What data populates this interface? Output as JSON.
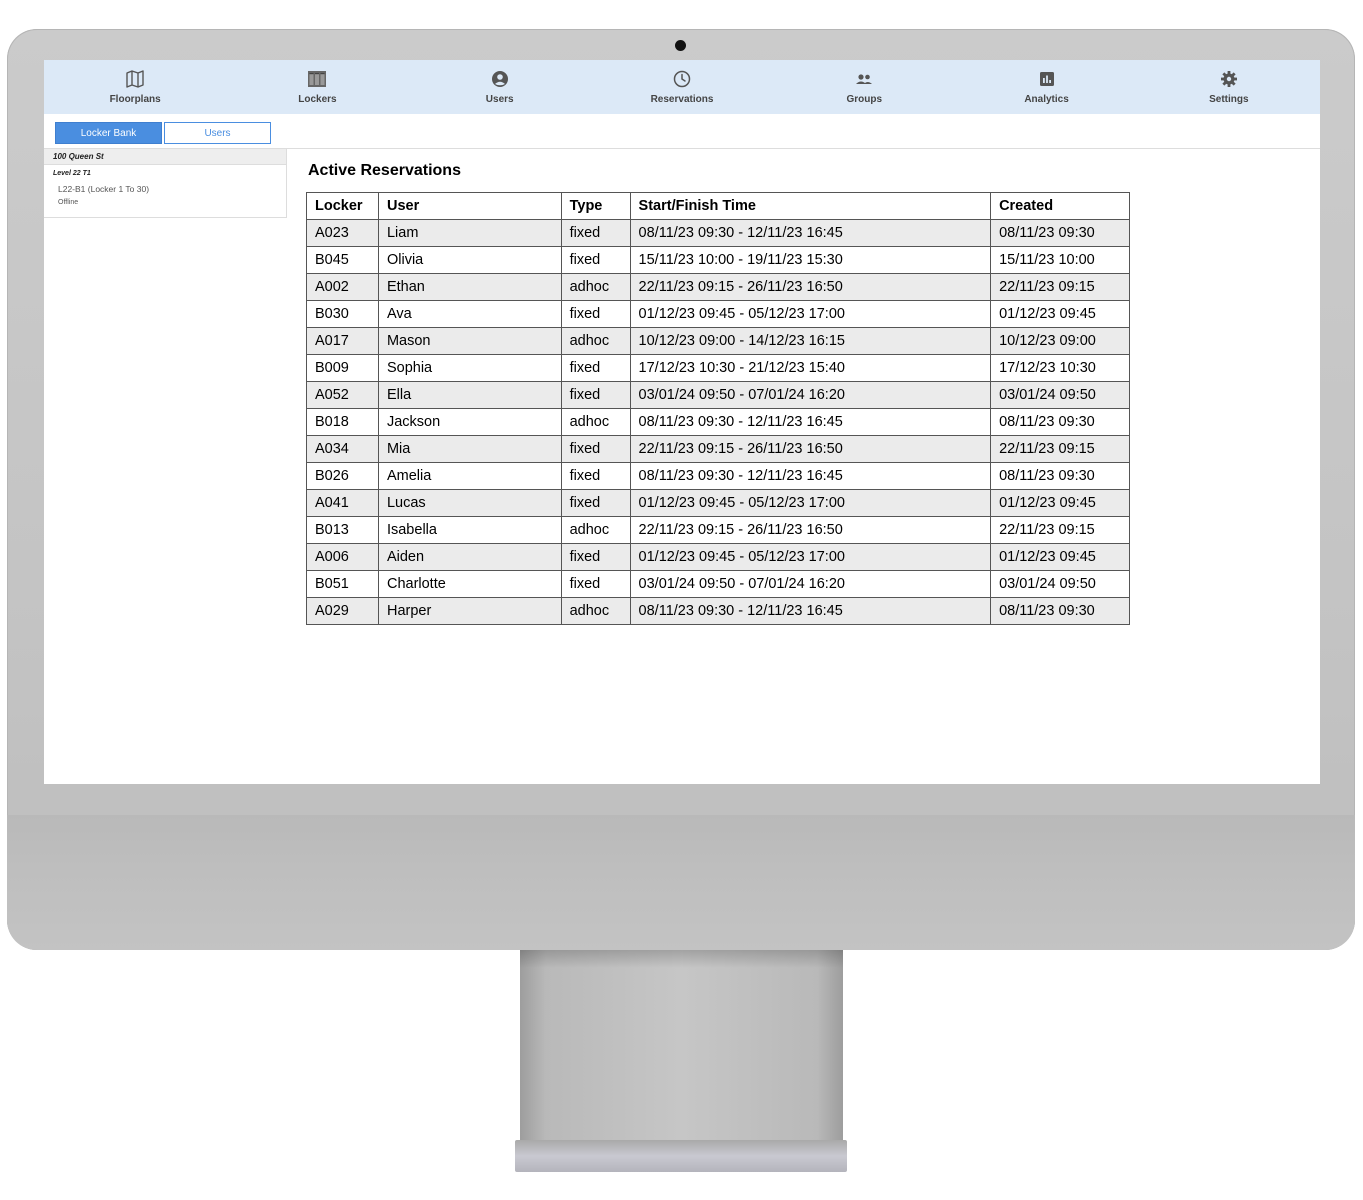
{
  "nav": [
    {
      "icon": "map-icon",
      "label": "Floorplans"
    },
    {
      "icon": "lockers-icon",
      "label": "Lockers"
    },
    {
      "icon": "user-icon",
      "label": "Users"
    },
    {
      "icon": "clock-icon",
      "label": "Reservations"
    },
    {
      "icon": "group-icon",
      "label": "Groups"
    },
    {
      "icon": "analytics-icon",
      "label": "Analytics"
    },
    {
      "icon": "gear-icon",
      "label": "Settings"
    }
  ],
  "tabs": {
    "active": "Locker Bank",
    "inactive": "Users"
  },
  "sidebar": {
    "site": "100 Queen St",
    "level": "Level 22 T1",
    "bank": "L22-B1 (Locker 1 To 30)",
    "status": "Offline"
  },
  "main": {
    "title": "Active Reservations",
    "columns": [
      "Locker",
      "User",
      "Type",
      "Start/Finish Time",
      "Created"
    ],
    "rows": [
      [
        "A023",
        "Liam",
        "fixed",
        "08/11/23 09:30 - 12/11/23 16:45",
        "08/11/23 09:30"
      ],
      [
        "B045",
        "Olivia",
        "fixed",
        "15/11/23 10:00 - 19/11/23 15:30",
        "15/11/23 10:00"
      ],
      [
        "A002",
        "Ethan",
        "adhoc",
        "22/11/23 09:15 - 26/11/23 16:50",
        "22/11/23 09:15"
      ],
      [
        "B030",
        "Ava",
        "fixed",
        "01/12/23 09:45 - 05/12/23 17:00",
        "01/12/23 09:45"
      ],
      [
        "A017",
        "Mason",
        "adhoc",
        "10/12/23 09:00 - 14/12/23 16:15",
        "10/12/23 09:00"
      ],
      [
        "B009",
        "Sophia",
        "fixed",
        "17/12/23 10:30 - 21/12/23 15:40",
        "17/12/23 10:30"
      ],
      [
        "A052",
        "Ella",
        "fixed",
        "03/01/24 09:50 - 07/01/24 16:20",
        "03/01/24 09:50"
      ],
      [
        "B018",
        "Jackson",
        "adhoc",
        "08/11/23 09:30 - 12/11/23 16:45",
        "08/11/23 09:30"
      ],
      [
        "A034",
        "Mia",
        "fixed",
        "22/11/23 09:15 - 26/11/23 16:50",
        "22/11/23 09:15"
      ],
      [
        "B026",
        "Amelia",
        "fixed",
        "08/11/23 09:30 - 12/11/23 16:45",
        "08/11/23 09:30"
      ],
      [
        "A041",
        "Lucas",
        "fixed",
        "01/12/23 09:45 - 05/12/23 17:00",
        "01/12/23 09:45"
      ],
      [
        "B013",
        "Isabella",
        "adhoc",
        "22/11/23 09:15 - 26/11/23 16:50",
        "22/11/23 09:15"
      ],
      [
        "A006",
        "Aiden",
        "fixed",
        "01/12/23 09:45 - 05/12/23 17:00",
        "01/12/23 09:45"
      ],
      [
        "B051",
        "Charlotte",
        "fixed",
        "03/01/24 09:50 - 07/01/24 16:20",
        "03/01/24 09:50"
      ],
      [
        "A029",
        "Harper",
        "adhoc",
        "08/11/23 09:30 - 12/11/23 16:45",
        "08/11/23 09:30"
      ]
    ]
  },
  "colors": {
    "nav_bg": "#dce9f7",
    "accent": "#4a8ee0",
    "row_alt": "#ebebeb"
  }
}
